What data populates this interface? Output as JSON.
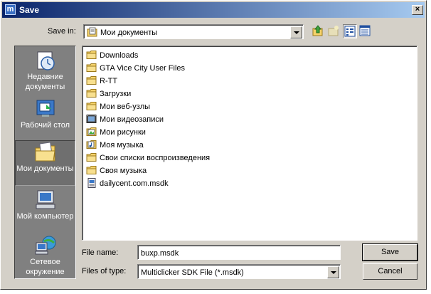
{
  "window": {
    "title": "Save",
    "app_icon_letter": "m",
    "close_glyph": "×"
  },
  "toolbar": {
    "save_in_label": "Save in:",
    "save_in_value": "Мои документы"
  },
  "places": [
    {
      "label": "Недавние документы",
      "icon": "recent-documents-icon"
    },
    {
      "label": "Рабочий стол",
      "icon": "desktop-icon"
    },
    {
      "label": "Мои документы",
      "icon": "my-documents-icon",
      "selected": true
    },
    {
      "label": "Мой компьютер",
      "icon": "my-computer-icon"
    },
    {
      "label": "Сетевое окружение",
      "icon": "network-icon"
    }
  ],
  "files": [
    {
      "name": "Downloads",
      "icon": "folder-icon"
    },
    {
      "name": "GTA Vice City User Files",
      "icon": "folder-icon"
    },
    {
      "name": "R-TT",
      "icon": "folder-icon"
    },
    {
      "name": "Загрузки",
      "icon": "folder-icon"
    },
    {
      "name": "Мои веб-узлы",
      "icon": "folder-icon"
    },
    {
      "name": "Мои видеозаписи",
      "icon": "video-folder-icon"
    },
    {
      "name": "Мои рисунки",
      "icon": "pictures-folder-icon"
    },
    {
      "name": "Моя музыка",
      "icon": "music-folder-icon"
    },
    {
      "name": "Свои списки воспроизведения",
      "icon": "folder-icon"
    },
    {
      "name": "Своя музыка",
      "icon": "folder-icon"
    },
    {
      "name": "dailycent.com.msdk",
      "icon": "file-icon"
    }
  ],
  "form": {
    "file_name_label": "File name:",
    "file_name_value": "buxp.msdk",
    "file_type_label": "Files of type:",
    "file_type_value": "Multiclicker SDK File (*.msdk)"
  },
  "buttons": {
    "save": "Save",
    "cancel": "Cancel"
  },
  "colors": {
    "titlebar_start": "#0a246a",
    "titlebar_end": "#a6caf0",
    "dialog_bg": "#d4d0c8",
    "places_bg": "#808080",
    "folder_yellow": "#f5d36b"
  }
}
